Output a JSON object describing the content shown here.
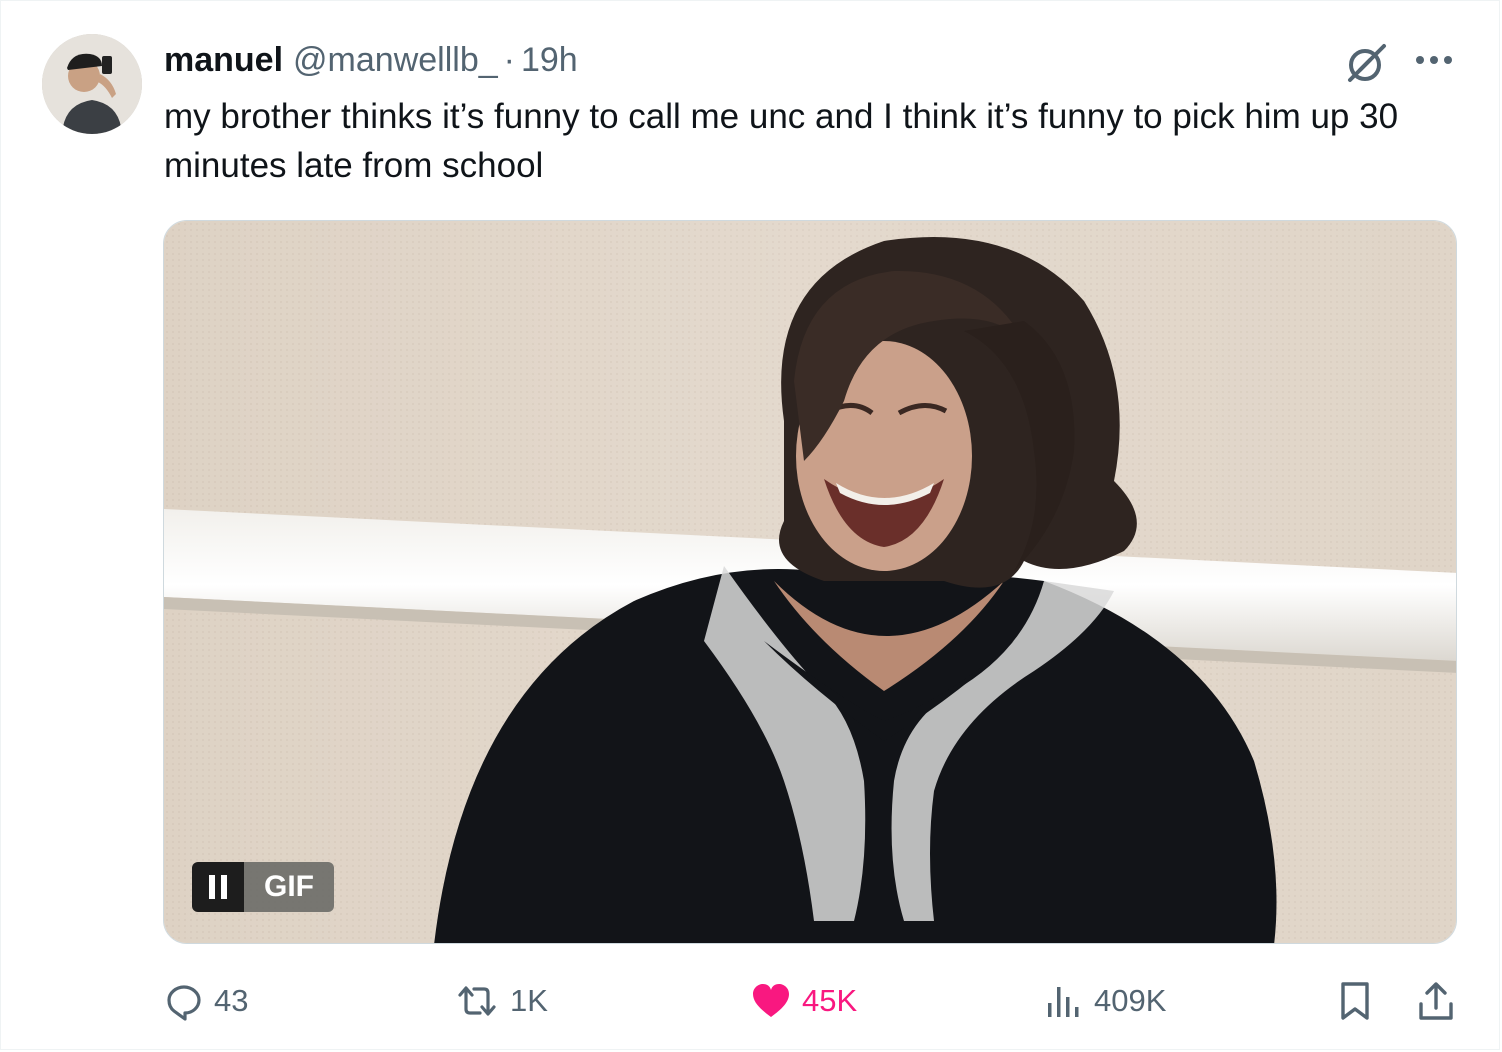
{
  "tweet": {
    "author": {
      "name": "manuel",
      "handle": "@manwelllb_",
      "separator": "·",
      "time": "19h"
    },
    "text": "my brother thinks it’s funny to call me unc and I think it’s funny to pick him up 30 minutes late from school",
    "media": {
      "type": "gif",
      "badge_label": "GIF"
    },
    "actions": {
      "replies": "43",
      "reposts": "1K",
      "likes": "45K",
      "views": "409K"
    }
  },
  "colors": {
    "text_primary": "#0f1419",
    "text_secondary": "#536471",
    "like_active": "#f91880"
  },
  "icons": [
    "grok-icon",
    "more-icon",
    "pause-icon",
    "reply-icon",
    "repost-icon",
    "like-icon",
    "views-icon",
    "bookmark-icon",
    "share-icon"
  ]
}
